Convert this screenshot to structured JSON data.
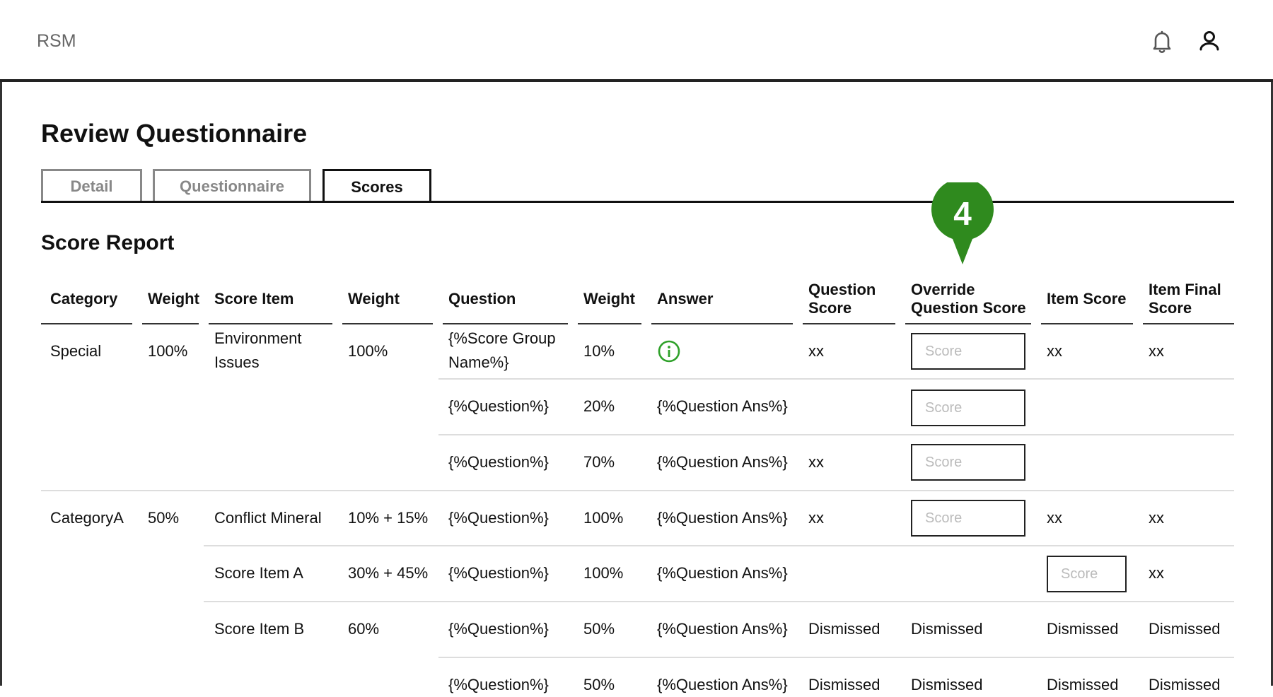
{
  "app": {
    "brand": "RSM"
  },
  "page": {
    "title": "Review Questionnaire",
    "section_title": "Score Report"
  },
  "tabs": [
    {
      "label": "Detail",
      "active": false
    },
    {
      "label": "Questionnaire",
      "active": false
    },
    {
      "label": "Scores",
      "active": true
    }
  ],
  "annotation": {
    "number": "4",
    "color": "#2f8a1e"
  },
  "colors": {
    "info": "#2fa12a",
    "line": "#222222"
  },
  "icons": {
    "notifications": "bell-icon",
    "profile": "user-icon",
    "info": "info-icon"
  },
  "table": {
    "headers": {
      "category": "Category",
      "weight1": "Weight",
      "score_item": "Score Item",
      "weight2": "Weight",
      "question": "Question",
      "weight3": "Weight",
      "answer": "Answer",
      "question_score": "Question Score",
      "override_score": "Override Question Score",
      "item_score": "Item Score",
      "item_final_score": "Item Final Score"
    },
    "score_placeholder": "Score",
    "rows": [
      {
        "category": "Special",
        "category_weight": "100%",
        "item": "Environment Issues",
        "item_weight": "100%",
        "question": "{%Score Group Name%}",
        "question_weight": "10%",
        "answer": "",
        "question_score": "xx",
        "override": "input",
        "item_score": "xx",
        "item_final": "xx"
      },
      {
        "category": "",
        "category_weight": "",
        "item": "",
        "item_weight": "",
        "question": "{%Question%}",
        "question_weight": "20%",
        "answer": "{%Question Ans%}",
        "question_score": "",
        "override": "input",
        "item_score": "",
        "item_final": ""
      },
      {
        "category": "",
        "category_weight": "",
        "item": "",
        "item_weight": "",
        "question": "{%Question%}",
        "question_weight": "70%",
        "answer": "{%Question Ans%}",
        "question_score": "xx",
        "override": "input",
        "item_score": "",
        "item_final": ""
      },
      {
        "category": "CategoryA",
        "category_weight": "50%",
        "item": "Conflict Mineral",
        "item_weight": "10% + 15%",
        "question": "{%Question%}",
        "question_weight": "100%",
        "answer": "{%Question Ans%}",
        "question_score": "xx",
        "override": "input",
        "item_score": "xx",
        "item_final": "xx"
      },
      {
        "category": "",
        "category_weight": "",
        "item": "Score Item A",
        "item_weight": "30% + 45%",
        "question": "{%Question%}",
        "question_weight": "100%",
        "answer": "{%Question Ans%}",
        "question_score": "",
        "override": "",
        "item_score": "input",
        "item_final": "xx"
      },
      {
        "category": "",
        "category_weight": "",
        "item": "Score Item B",
        "item_weight": "60%",
        "question": "{%Question%}",
        "question_weight": "50%",
        "answer": "{%Question Ans%}",
        "question_score": "Dismissed",
        "override": "Dismissed",
        "item_score": "Dismissed",
        "item_final": "Dismissed"
      },
      {
        "category": "",
        "category_weight": "",
        "item": "",
        "item_weight": "",
        "question": "{%Question%}",
        "question_weight": "50%",
        "answer": "{%Question Ans%}",
        "question_score": "Dismissed",
        "override": "Dismissed",
        "item_score": "Dismissed",
        "item_final": "Dismissed"
      }
    ]
  }
}
